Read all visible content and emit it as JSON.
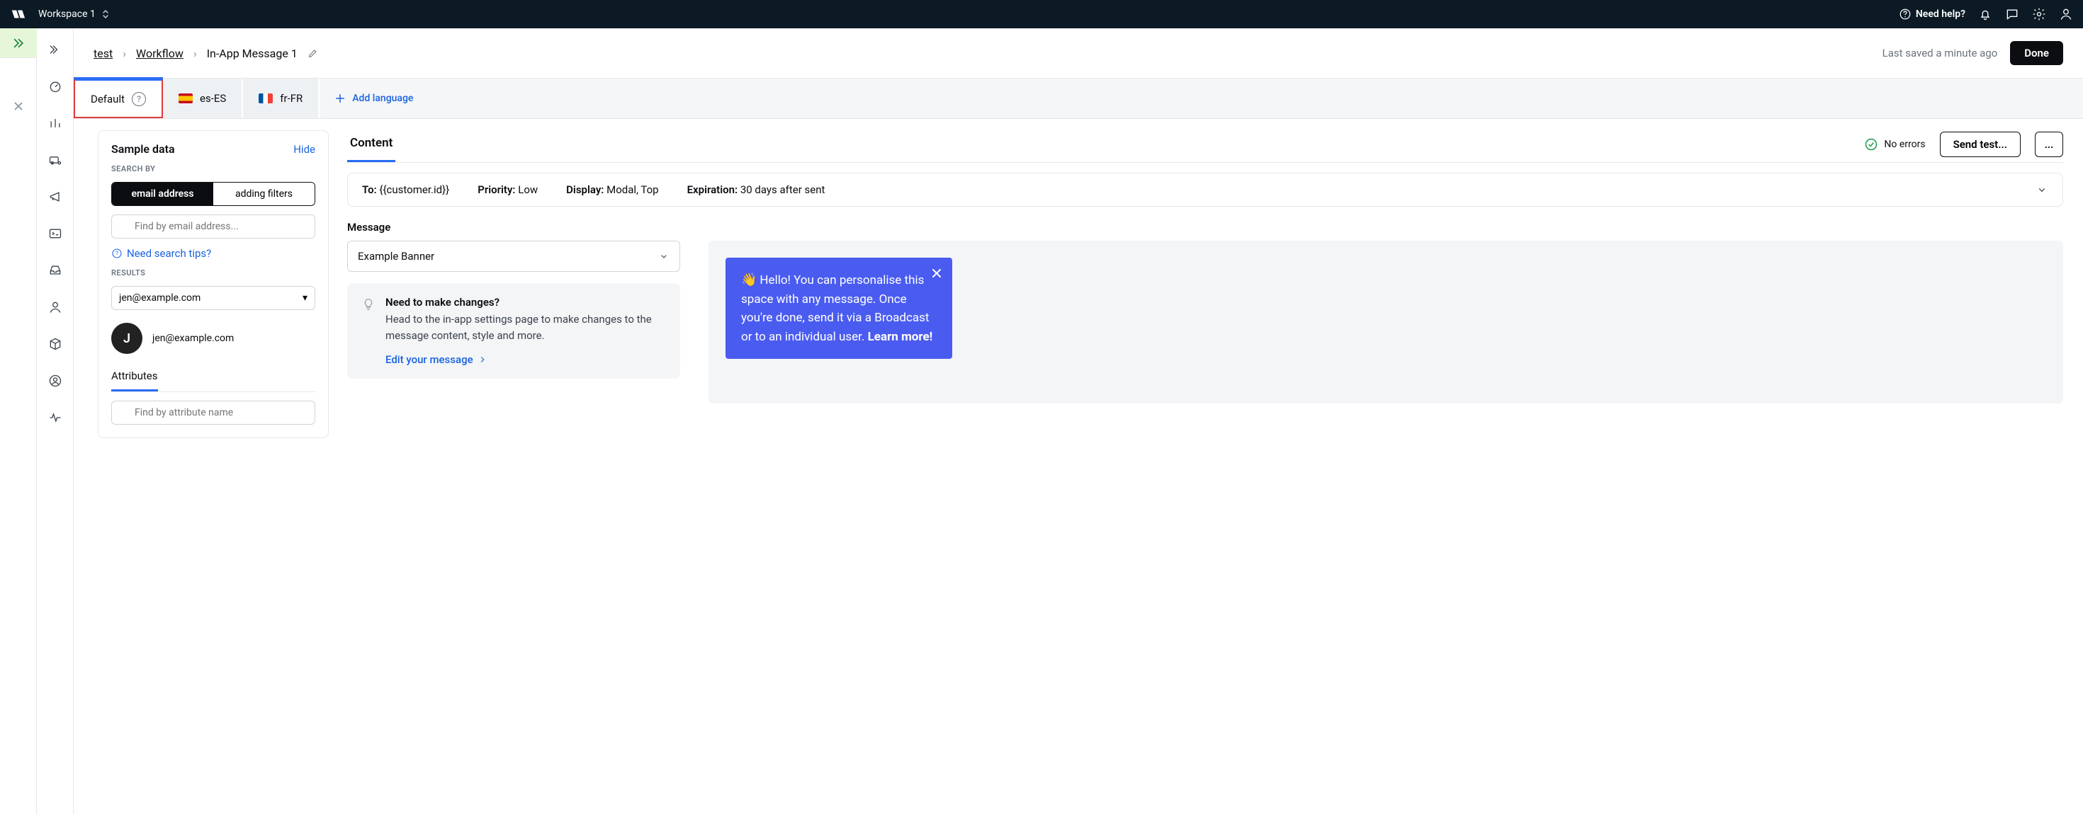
{
  "topbar": {
    "workspace": "Workspace 1",
    "need_help": "Need help?"
  },
  "breadcrumbs": {
    "a": "test",
    "b": "Workflow",
    "c": "In-App Message 1"
  },
  "pagehead": {
    "saved": "Last saved a minute ago",
    "done": "Done"
  },
  "lang_tabs": {
    "default": "Default",
    "es": "es-ES",
    "fr": "fr-FR",
    "add": "Add language"
  },
  "sample": {
    "title": "Sample data",
    "hide": "Hide",
    "search_by": "SEARCH BY",
    "seg_email": "email address",
    "seg_filters": "adding filters",
    "search_ph": "Find by email address...",
    "tips": "Need search tips?",
    "results": "RESULTS",
    "selected": "jen@example.com",
    "avatar_initial": "J",
    "person_email": "jen@example.com",
    "subtab_attributes": "Attributes",
    "attr_search_ph": "Find by attribute name"
  },
  "content": {
    "tab": "Content",
    "no_errors": "No errors",
    "send_test": "Send test...",
    "more": "..."
  },
  "meta": {
    "to_label": "To:",
    "to_value": "{{customer.id}}",
    "priority_label": "Priority:",
    "priority_value": "Low",
    "display_label": "Display:",
    "display_value": "Modal, Top",
    "expiration_label": "Expiration:",
    "expiration_value": "30 days after sent"
  },
  "message": {
    "label": "Message",
    "selected": "Example Banner",
    "hint_title": "Need to make changes?",
    "hint_body": "Head to the in-app settings page to make changes to the message content, style and more.",
    "edit": "Edit your message"
  },
  "banner": {
    "body": "Hello! You can personalise this space with any message. Once you're done, send it via a Broadcast or to an individual user. ",
    "learn_more": "Learn more!"
  }
}
